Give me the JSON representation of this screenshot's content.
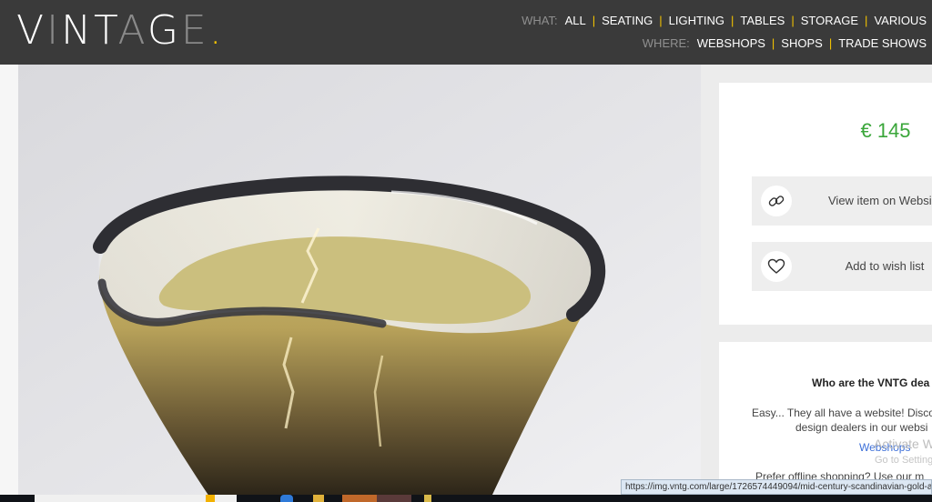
{
  "header": {
    "logo": {
      "v": "V",
      "i": "I",
      "n": "N",
      "t": "T",
      "a": "A",
      "g": "G",
      "e": "E",
      "dot": "."
    },
    "what": {
      "label": "WHAT:",
      "items": [
        "ALL",
        "SEATING",
        "LIGHTING",
        "TABLES",
        "STORAGE",
        "VARIOUS"
      ]
    },
    "where": {
      "label": "WHERE:",
      "items": [
        "WEBSHOPS",
        "SHOPS",
        "TRADE SHOWS"
      ]
    }
  },
  "product": {
    "price": "€ 145",
    "view_label": "View item on Websi",
    "wish_label": "Add to wish list",
    "view_icon": "link-icon",
    "wish_icon": "heart-icon"
  },
  "info": {
    "title": "Who are the VNTG dea",
    "line1": "Easy... They all have a website! Disco",
    "line2": "design dealers in our websi",
    "link": "Webshops",
    "line3": "Prefer offline shopping? Use our m"
  },
  "os_overlay": {
    "activate": "Activate W",
    "go_to": "Go to Setting"
  },
  "status_bar": {
    "url": "https://img.vntg.com/large/1726574449094/mid-century-scandinavian-gold-and-b"
  },
  "colors": {
    "header_bg": "#3a3a3a",
    "accent": "#f5c400",
    "price": "#3aa63a",
    "link": "#3c6fd8"
  }
}
